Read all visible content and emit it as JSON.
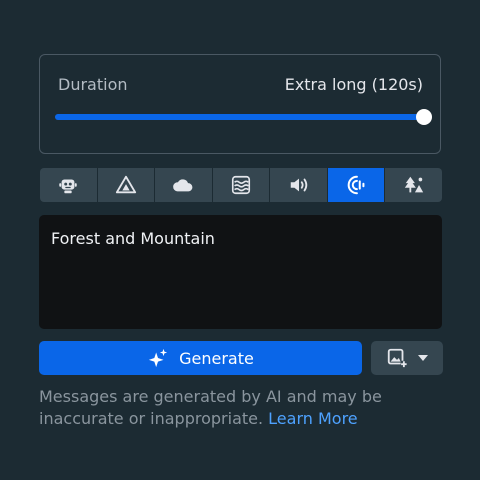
{
  "duration": {
    "label": "Duration",
    "value_text": "Extra long (120s)",
    "level_fraction": 1.0
  },
  "colors": {
    "accent": "#0a66e8",
    "background": "#1c2b33",
    "button_bg": "#354650",
    "link": "#4ea2ff"
  },
  "icons": [
    {
      "name": "robot-icon",
      "selected": false
    },
    {
      "name": "camping-tent-icon",
      "selected": false
    },
    {
      "name": "cloud-icon",
      "selected": false
    },
    {
      "name": "waves-icon",
      "selected": false
    },
    {
      "name": "speaker-volume-icon",
      "selected": false
    },
    {
      "name": "sound-waves-icon",
      "selected": true
    },
    {
      "name": "forest-trees-icon",
      "selected": false
    }
  ],
  "prompt": {
    "value": "Forest and Mountain"
  },
  "generate": {
    "label": "Generate",
    "icon": "sparkle-icon"
  },
  "image_button": {
    "icon": "add-image-icon",
    "caret": "chevron-down-icon"
  },
  "disclaimer": {
    "text": "Messages are generated by AI and may be inaccurate or inappropriate.",
    "link": "Learn More"
  }
}
